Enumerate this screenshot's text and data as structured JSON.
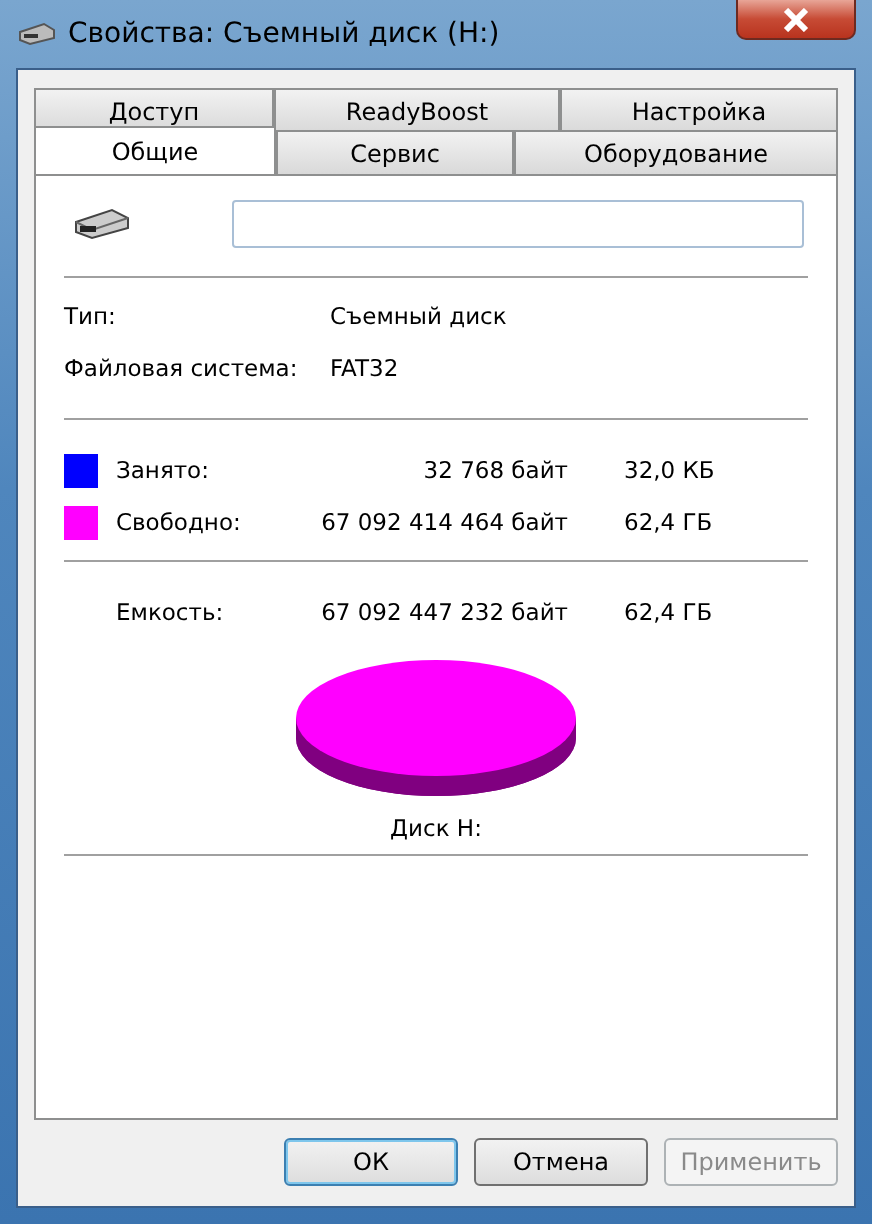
{
  "window": {
    "title": "Свойства: Съемный диск (H:)"
  },
  "tab_rows": [
    [
      {
        "label": "Доступ",
        "selected": false
      },
      {
        "label": "ReadyBoost",
        "selected": false
      },
      {
        "label": "Настройка",
        "selected": false
      }
    ],
    [
      {
        "label": "Общие",
        "selected": true
      },
      {
        "label": "Сервис",
        "selected": false
      },
      {
        "label": "Оборудование",
        "selected": false
      }
    ]
  ],
  "info": [
    {
      "label": "Тип:",
      "value": "Съемный диск"
    },
    {
      "label": "Файловая система:",
      "value": "FAT32"
    }
  ],
  "usage": [
    {
      "label": "Занято:",
      "bytes": "32 768 байт",
      "size": "32,0 КБ",
      "color": "#0000ff"
    },
    {
      "label": "Свободно:",
      "bytes": "67 092 414 464 байт",
      "size": "62,4 ГБ",
      "color": "#ff00ff"
    }
  ],
  "capacity": {
    "label": "Емкость:",
    "bytes": "67 092 447 232 байт",
    "size": "62,4 ГБ"
  },
  "disk_label": "Диск H:",
  "buttons": [
    {
      "label": "ОК",
      "default": true,
      "disabled": false
    },
    {
      "label": "Отмена",
      "default": false,
      "disabled": false
    },
    {
      "label": "Применить",
      "default": false,
      "disabled": true
    }
  ]
}
